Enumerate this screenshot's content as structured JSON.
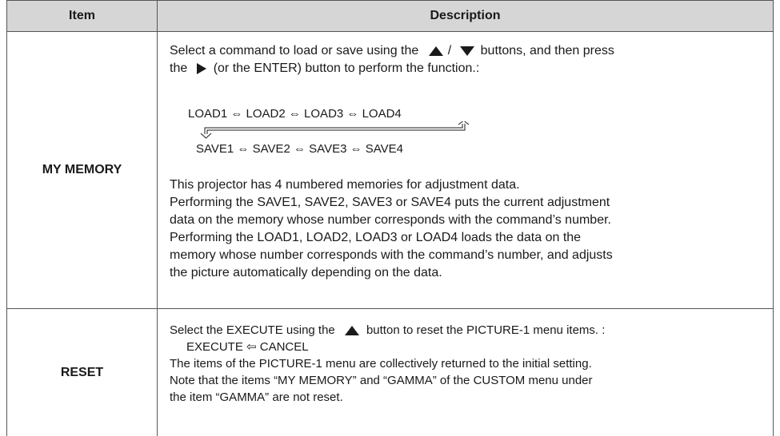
{
  "header": {
    "item": "Item",
    "description": "Description"
  },
  "my_memory": {
    "name": "MY MEMORY",
    "intro_1a": "Select a command to load or save using the",
    "intro_1b": "/",
    "intro_1c": "buttons, and then press",
    "intro_2a": "the",
    "intro_2b": "(or the ENTER) button to perform the function.:",
    "load_sequence": "LOAD1 ⇔ LOAD2 ⇔ LOAD3 ⇔ LOAD4",
    "save_sequence": "SAVE1 ⇔ SAVE2 ⇔ SAVE3 ⇔ SAVE4",
    "paragraph": [
      "This projector has 4 numbered memories for adjustment data.",
      "Performing the SAVE1, SAVE2, SAVE3 or SAVE4 puts the current adjustment",
      "data on the memory whose number corresponds with the command’s number.",
      "Performing the LOAD1, LOAD2, LOAD3 or LOAD4 loads the data on the",
      "memory whose number corresponds with the command’s number, and adjusts",
      "the picture automatically depending on the data."
    ]
  },
  "reset": {
    "name": "RESET",
    "intro_a": "Select the EXECUTE using the",
    "intro_b": "button to reset the PICTURE-1 menu items. :",
    "execute_line": "EXECUTE ⇦ CANCEL",
    "paragraph": [
      "The items of the PICTURE-1 menu are collectively returned to the initial setting.",
      "Note that the items “MY MEMORY” and “GAMMA” of the CUSTOM menu under",
      "the item “GAMMA” are not reset."
    ]
  }
}
